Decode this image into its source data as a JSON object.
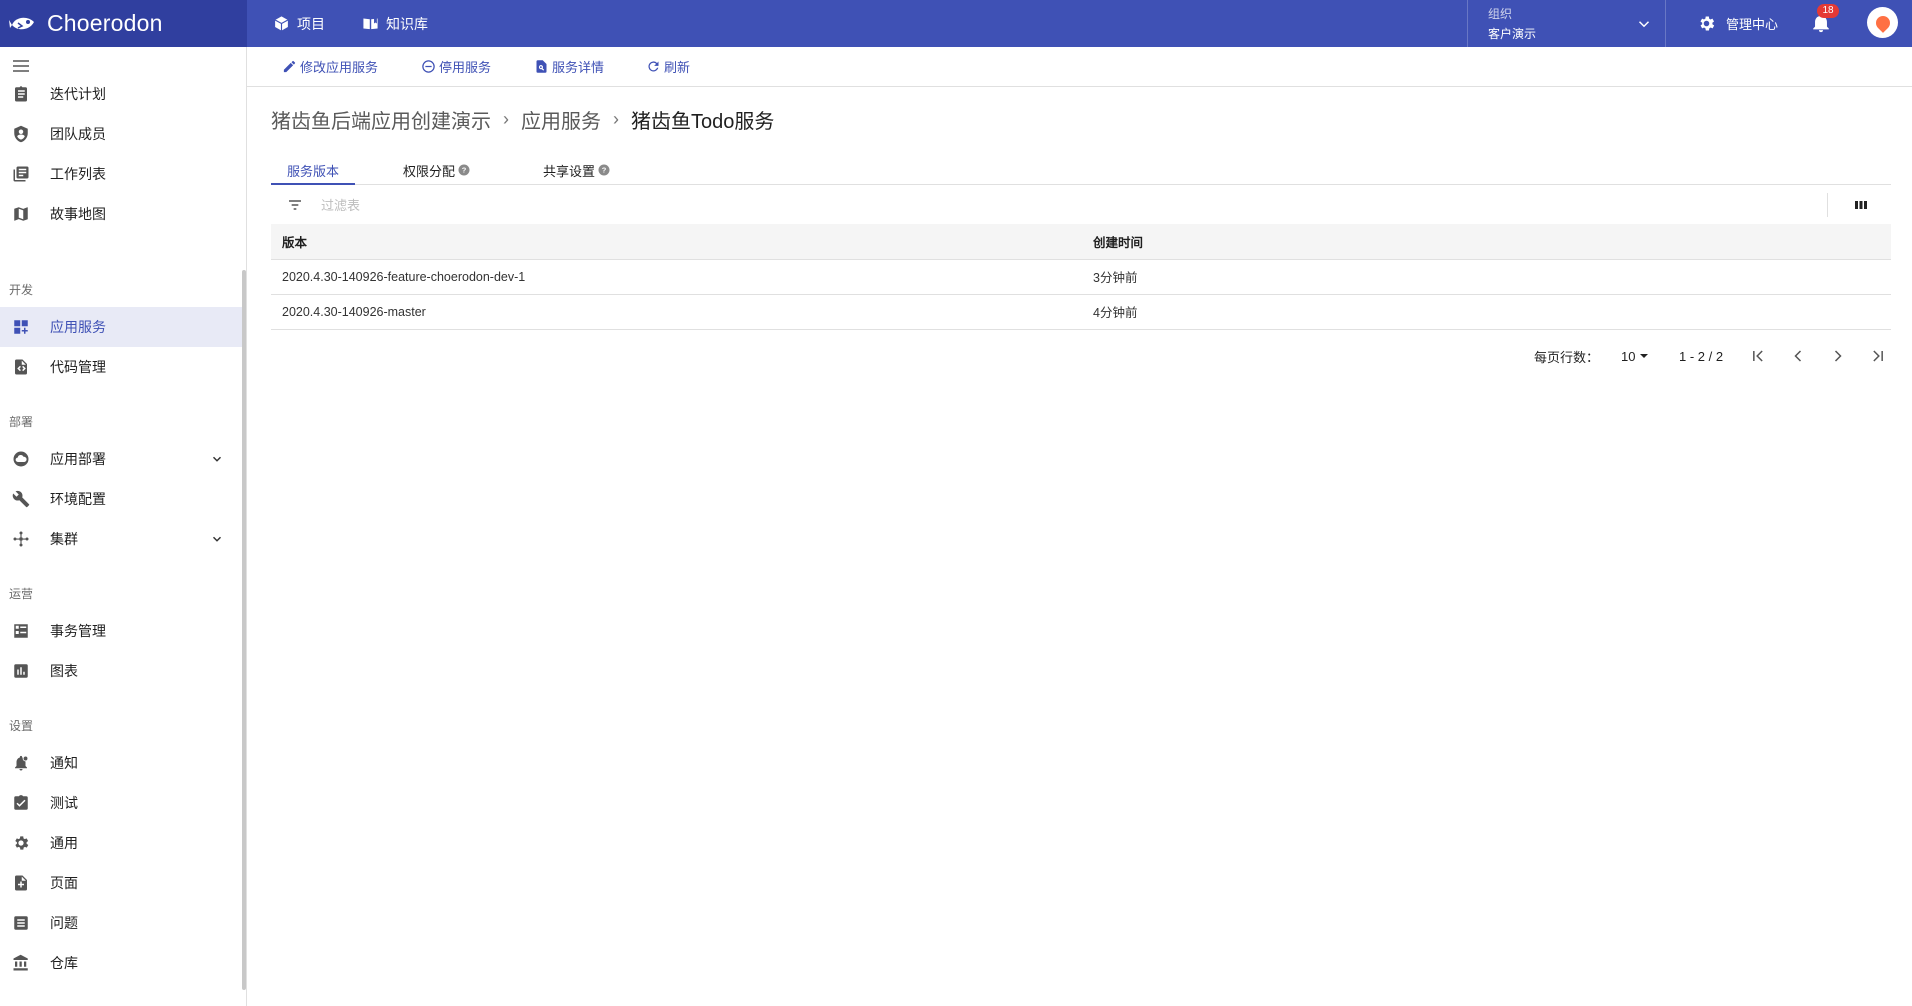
{
  "brand": {
    "name": "Choerodon"
  },
  "topnav": {
    "projects": "项目",
    "knowledge": "知识库"
  },
  "org": {
    "label": "组织",
    "value": "客户演示"
  },
  "management": {
    "label": "管理中心"
  },
  "notifications": {
    "count": "18"
  },
  "colors": {
    "primary": "#3f51b5",
    "brand_dark": "#303f9f",
    "active_bg": "#e8eaf6",
    "badge": "#e53935"
  },
  "sidebar": {
    "items": [
      {
        "label": "迭代计划",
        "icon": "clipboard-icon"
      },
      {
        "label": "团队成员",
        "icon": "shield-user-icon"
      },
      {
        "label": "工作列表",
        "icon": "list-icon"
      },
      {
        "label": "故事地图",
        "icon": "map-icon"
      },
      {
        "label": "应用服务",
        "icon": "dashboard-icon"
      },
      {
        "label": "代码管理",
        "icon": "code-file-icon"
      },
      {
        "label": "应用部署",
        "icon": "cloud-icon"
      },
      {
        "label": "环境配置",
        "icon": "wrench-icon"
      },
      {
        "label": "集群",
        "icon": "cluster-icon"
      },
      {
        "label": "事务管理",
        "icon": "task-icon"
      },
      {
        "label": "图表",
        "icon": "bar-chart-icon"
      },
      {
        "label": "通知",
        "icon": "notification-icon"
      },
      {
        "label": "测试",
        "icon": "test-check-icon"
      },
      {
        "label": "通用",
        "icon": "gear-icon"
      },
      {
        "label": "页面",
        "icon": "page-add-icon"
      },
      {
        "label": "问题",
        "icon": "list-alt-icon"
      },
      {
        "label": "仓库",
        "icon": "bank-icon"
      }
    ],
    "sections": {
      "dev": "开发",
      "deploy": "部署",
      "ops": "运营",
      "settings": "设置"
    }
  },
  "toolbar": {
    "edit": "修改应用服务",
    "disable": "停用服务",
    "details": "服务详情",
    "refresh": "刷新"
  },
  "breadcrumb": {
    "items": [
      "猪齿鱼后端应用创建演示",
      "应用服务",
      "猪齿鱼Todo服务"
    ],
    "separator": "›"
  },
  "tabs": [
    {
      "label": "服务版本",
      "active": true
    },
    {
      "label": "权限分配",
      "help": true
    },
    {
      "label": "共享设置",
      "help": true
    }
  ],
  "filter": {
    "placeholder": "过滤表"
  },
  "table": {
    "columns": [
      "版本",
      "创建时间"
    ],
    "rows": [
      [
        "2020.4.30-140926-feature-choerodon-dev-1",
        "3分钟前"
      ],
      [
        "2020.4.30-140926-master",
        "4分钟前"
      ]
    ]
  },
  "pagination": {
    "rows_label": "每页行数：",
    "page_size": "10",
    "range": "1 - 2 / 2"
  }
}
